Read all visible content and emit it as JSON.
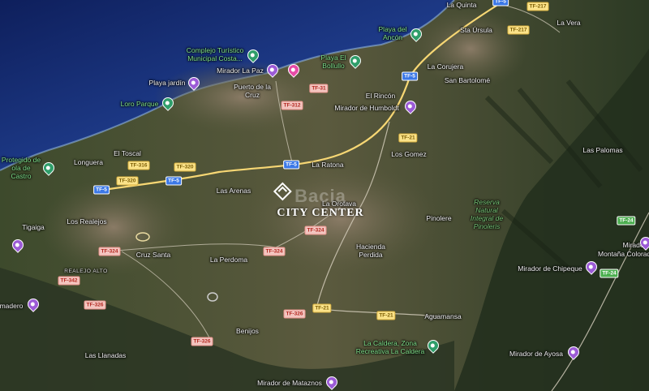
{
  "watermark": {
    "logo_text": "Bacia",
    "tagline": "CITY CENTER"
  },
  "colors": {
    "sea": "#1f3d8c",
    "deep_sea": "#0e1f5c",
    "land": "#4a5337",
    "urban": "#7d6f5c",
    "mountain": "#23301e",
    "highway": "#f7d774",
    "secondary_road": "#d9d2c1"
  },
  "places": {
    "la_quinta": "La Quinta",
    "sta_ursula": "Sta Úrsula",
    "la_vera": "La Vera",
    "la_corujera": "La Corujera",
    "san_bartolome": "San Bartolomé",
    "el_rincon": "El Rincón",
    "puerto": "Puerto de la Cruz",
    "el_toscal": "El Toscal",
    "longuera": "Longuera",
    "la_ratona": "La Ratona",
    "los_gomez": "Los Gomez",
    "las_palomas": "Las Palomas",
    "las_arenas": "Las Arenas",
    "la_orotava": "La Orotava",
    "pinolere": "Pinolere",
    "tigaiga": "Tigaiga",
    "los_realejos": "Los Realejos",
    "cruz_santa": "Cruz Santa",
    "la_perdoma": "La Perdoma",
    "hacienda_perdida": "Hacienda Perdida",
    "realejo_alto": "REALEJO ALTO",
    "aguamansa": "Aguamansa",
    "benijos": "Benijos",
    "las_llanadas": "Las Llanadas",
    "madero": "madero",
    "mirador_right": "Mirador",
    "montana_colorada": "Montaña Colorada"
  },
  "pois": {
    "playa_ancon": "Playa del Ancón",
    "complejo": "Complejo Turístico Municipal Costa...",
    "mirador_la_paz": "Mirador La Paz",
    "playa_bollullo": "Playa El Bollullo",
    "playa_jardin": "Playa jardín",
    "loro_parque": "Loro Parque",
    "mirador_humboldt": "Mirador de Humboldt",
    "protegido": "Protegido de ola de Castro",
    "reserva": "Reserva Natural Integral de Pinoleris",
    "mirador_chipeque": "Mirador de Chipeque",
    "la_caldera": "La Caldera, Zona Recreativa La Caldera",
    "mirador_ayosa": "Mirador de Ayosa",
    "mirador_mataznos": "Mirador de Mataznos"
  },
  "roads": {
    "tf5": "TF-5",
    "tf217": "TF-217",
    "tf31": "TF-31",
    "tf312": "TF-312",
    "tf316": "TF-316",
    "tf320": "TF-320",
    "tf21": "TF-21",
    "tf324": "TF-324",
    "tf342": "TF-342",
    "tf326": "TF-326",
    "tf24": "TF-24"
  }
}
